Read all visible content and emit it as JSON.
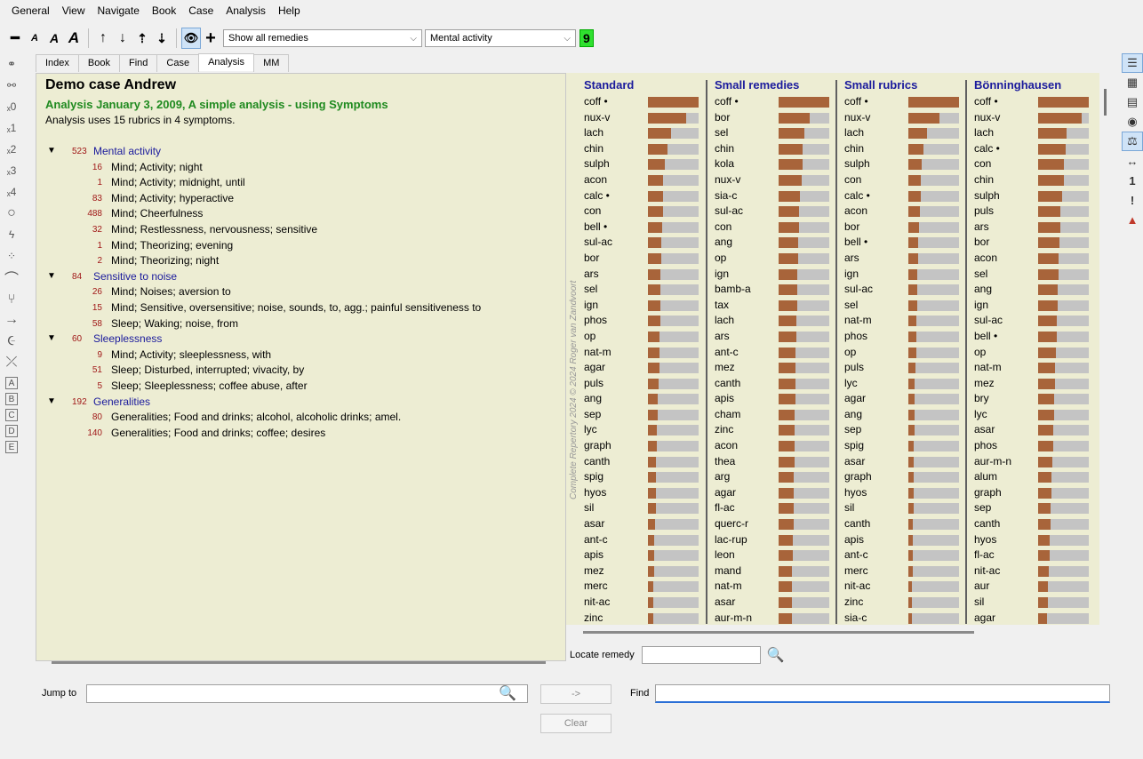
{
  "menu": [
    "General",
    "View",
    "Navigate",
    "Book",
    "Case",
    "Analysis",
    "Help"
  ],
  "toolbar": {
    "remedy_filter": "Show all remedies",
    "symptom_filter": "Mental activity",
    "count": "9"
  },
  "left_tools": [
    "link",
    "unlink",
    "×0",
    "×1",
    "×2",
    "×3",
    "×4"
  ],
  "left_tools_letters": [
    "A",
    "B",
    "C",
    "D",
    "E"
  ],
  "tabs": [
    "Index",
    "Book",
    "Find",
    "Case",
    "Analysis",
    "MM"
  ],
  "case": {
    "title": "Demo case Andrew",
    "analysis_title": "Analysis January 3, 2009, A simple analysis - using Symptoms",
    "info": "Analysis uses 15 rubrics in 4 symptoms."
  },
  "tree": [
    {
      "type": "sym",
      "count": "523",
      "name": "Mental activity"
    },
    {
      "type": "rub",
      "count": "16",
      "name": "Mind; Activity; night"
    },
    {
      "type": "rub",
      "count": "1",
      "name": "Mind; Activity; midnight, until"
    },
    {
      "type": "rub",
      "count": "83",
      "name": "Mind; Activity; hyperactive"
    },
    {
      "type": "rub",
      "count": "488",
      "name": "Mind; Cheerfulness"
    },
    {
      "type": "rub",
      "count": "32",
      "name": "Mind; Restlessness, nervousness; sensitive"
    },
    {
      "type": "rub",
      "count": "1",
      "name": "Mind; Theorizing; evening"
    },
    {
      "type": "rub",
      "count": "2",
      "name": "Mind; Theorizing; night"
    },
    {
      "type": "sym",
      "count": "84",
      "name": "Sensitive to noise"
    },
    {
      "type": "rub",
      "count": "26",
      "name": "Mind; Noises; aversion to"
    },
    {
      "type": "rub",
      "count": "15",
      "name": "Mind; Sensitive, oversensitive; noise, sounds, to, agg.; painful sensitiveness to"
    },
    {
      "type": "rub",
      "count": "58",
      "name": "Sleep; Waking; noise, from"
    },
    {
      "type": "sym",
      "count": "60",
      "name": "Sleeplessness"
    },
    {
      "type": "rub",
      "count": "9",
      "name": "Mind; Activity; sleeplessness, with"
    },
    {
      "type": "rub",
      "count": "51",
      "name": "Sleep; Disturbed, interrupted; vivacity, by"
    },
    {
      "type": "rub",
      "count": "5",
      "name": "Sleep; Sleeplessness; coffee abuse, after"
    },
    {
      "type": "sym",
      "count": "192",
      "name": "Generalities"
    },
    {
      "type": "rub",
      "count": "80",
      "name": "Generalities; Food and drinks; alcohol, alcoholic drinks; amel."
    },
    {
      "type": "rub",
      "count": "140",
      "name": "Generalities; Food and drinks; coffee; desires"
    }
  ],
  "watermark": "Complete Repertory 2024 © 2024 Roger van Zandvoort",
  "columns": [
    {
      "title": "Standard",
      "remedies": [
        "coff •",
        "nux-v",
        "lach",
        "chin",
        "sulph",
        "acon",
        "calc •",
        "con",
        "bell •",
        "sul-ac",
        "bor",
        "ars",
        "sel",
        "ign",
        "phos",
        "op",
        "nat-m",
        "agar",
        "puls",
        "ang",
        "sep",
        "lyc",
        "graph",
        "canth",
        "spig",
        "hyos",
        "sil",
        "asar",
        "ant-c",
        "apis",
        "mez",
        "merc",
        "nit-ac",
        "zinc"
      ],
      "scores": [
        1.0,
        0.75,
        0.45,
        0.38,
        0.34,
        0.3,
        0.3,
        0.29,
        0.28,
        0.26,
        0.26,
        0.25,
        0.25,
        0.24,
        0.24,
        0.23,
        0.23,
        0.22,
        0.21,
        0.2,
        0.19,
        0.18,
        0.17,
        0.16,
        0.16,
        0.15,
        0.15,
        0.14,
        0.13,
        0.12,
        0.12,
        0.11,
        0.1,
        0.1
      ]
    },
    {
      "title": "Small remedies",
      "remedies": [
        "coff •",
        "bor",
        "sel",
        "chin",
        "kola",
        "nux-v",
        "sia-c",
        "sul-ac",
        "con",
        "ang",
        "op",
        "ign",
        "bamb-a",
        "tax",
        "lach",
        "ars",
        "ant-c",
        "mez",
        "canth",
        "apis",
        "cham",
        "zinc",
        "acon",
        "thea",
        "arg",
        "agar",
        "fl-ac",
        "querc-r",
        "lac-rup",
        "leon",
        "mand",
        "nat-m",
        "asar",
        "aur-m-n"
      ],
      "scores": [
        1.0,
        0.62,
        0.5,
        0.48,
        0.47,
        0.45,
        0.42,
        0.4,
        0.4,
        0.38,
        0.38,
        0.37,
        0.36,
        0.36,
        0.35,
        0.35,
        0.34,
        0.34,
        0.33,
        0.33,
        0.32,
        0.32,
        0.31,
        0.31,
        0.3,
        0.3,
        0.29,
        0.29,
        0.28,
        0.28,
        0.27,
        0.27,
        0.26,
        0.26
      ]
    },
    {
      "title": "Small rubrics",
      "remedies": [
        "coff •",
        "nux-v",
        "lach",
        "chin",
        "sulph",
        "con",
        "calc •",
        "acon",
        "bor",
        "bell •",
        "ars",
        "ign",
        "sul-ac",
        "sel",
        "nat-m",
        "phos",
        "op",
        "puls",
        "lyc",
        "agar",
        "ang",
        "sep",
        "spig",
        "asar",
        "graph",
        "hyos",
        "sil",
        "canth",
        "apis",
        "ant-c",
        "merc",
        "nit-ac",
        "zinc",
        "sia-c"
      ],
      "scores": [
        1.0,
        0.62,
        0.36,
        0.3,
        0.27,
        0.25,
        0.24,
        0.22,
        0.21,
        0.2,
        0.19,
        0.18,
        0.17,
        0.17,
        0.16,
        0.15,
        0.15,
        0.14,
        0.13,
        0.13,
        0.12,
        0.12,
        0.11,
        0.11,
        0.1,
        0.1,
        0.1,
        0.09,
        0.09,
        0.08,
        0.08,
        0.07,
        0.07,
        0.07
      ]
    },
    {
      "title": "Bönninghausen",
      "remedies": [
        "coff •",
        "nux-v",
        "lach",
        "calc •",
        "con",
        "chin",
        "sulph",
        "puls",
        "ars",
        "bor",
        "acon",
        "sel",
        "ang",
        "ign",
        "sul-ac",
        "bell •",
        "op",
        "nat-m",
        "mez",
        "bry",
        "lyc",
        "asar",
        "phos",
        "aur-m-n",
        "alum",
        "graph",
        "sep",
        "canth",
        "hyos",
        "fl-ac",
        "nit-ac",
        "aur",
        "sil",
        "agar"
      ],
      "scores": [
        1.0,
        0.86,
        0.56,
        0.54,
        0.5,
        0.5,
        0.48,
        0.44,
        0.43,
        0.42,
        0.41,
        0.4,
        0.39,
        0.38,
        0.37,
        0.36,
        0.35,
        0.34,
        0.33,
        0.32,
        0.31,
        0.3,
        0.29,
        0.28,
        0.27,
        0.26,
        0.25,
        0.24,
        0.23,
        0.22,
        0.21,
        0.2,
        0.19,
        0.18
      ]
    }
  ],
  "locate": {
    "label": "Locate remedy",
    "value": ""
  },
  "bottom": {
    "jump_label": "Jump to",
    "jump_value": "",
    "go_label": "->",
    "clear_label": "Clear",
    "find_label": "Find",
    "find_value": ""
  },
  "colors": {
    "accent_green": "#1f8a1f",
    "bar_fill": "#a8643a",
    "bar_bg": "#c4c4c4",
    "symptom_blue": "#1a1a9c",
    "count_red": "#a01818",
    "panel_bg": "#ededd3"
  }
}
